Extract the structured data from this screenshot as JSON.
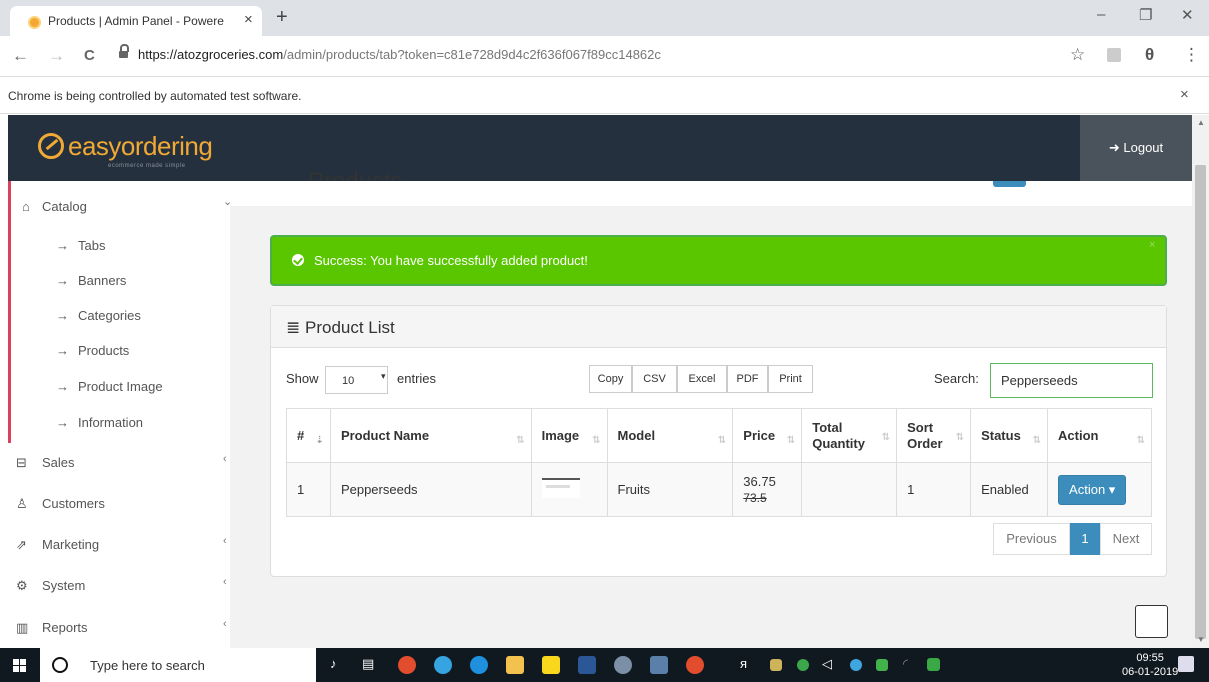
{
  "browser": {
    "tab_title": "Products | Admin Panel - Powere",
    "tab_close": "×",
    "new_tab": "+",
    "url_host": "https://atozgroceries.com",
    "url_path": "/admin/products/tab?token=c81e728d9d4c2f636f067f89cc14862c",
    "infobar_text": "Chrome is being controlled by automated test software.",
    "infobar_close": "×",
    "back": "←",
    "forward": "→",
    "reload": "C",
    "star": "☆",
    "profile": "θ",
    "menu": "⋮",
    "minimize": "–",
    "restore": "❐",
    "close": "✕"
  },
  "header": {
    "logo_text": "easyordering",
    "logo_tagline": "ecommerce made simple",
    "logout_label": "Logout",
    "logout_icon": "➜"
  },
  "page": {
    "title": "Products"
  },
  "sidebar": {
    "catalog": "Catalog",
    "catalog_chevron": "⌄",
    "sub_items": [
      "Tabs",
      "Banners",
      "Categories",
      "Products",
      "Product Image",
      "Information"
    ],
    "arrow": "→",
    "sales": "Sales",
    "customers": "Customers",
    "marketing": "Marketing",
    "system": "System",
    "reports": "Reports",
    "chevron_left": "‹"
  },
  "alert": {
    "message": "Success: You have successfully added product!",
    "close": "×"
  },
  "panel": {
    "title": "Product List",
    "title_icon": "≣"
  },
  "datatable": {
    "show_label": "Show",
    "length_value": "10",
    "length_caret": "▾",
    "entries_label": "entries",
    "buttons": [
      "Copy",
      "CSV",
      "Excel",
      "PDF",
      "Print"
    ],
    "search_label": "Search:",
    "search_value": "Pepperseeds",
    "columns": [
      "#",
      "Product Name",
      "Image",
      "Model",
      "Price",
      "Total Quantity",
      "Sort Order",
      "Status",
      "Action"
    ],
    "sort_icon": "⇅",
    "rows": [
      {
        "index": "1",
        "name": "Pepperseeds",
        "model": "Fruits",
        "price": "36.75",
        "old_price": "73.5",
        "quantity": "",
        "sort_order": "1",
        "status": "Enabled",
        "action": "Action ▾"
      }
    ],
    "pager": {
      "previous": "Previous",
      "current": "1",
      "next": "Next"
    }
  },
  "taskbar": {
    "search_placeholder": "Type here to search",
    "time": "09:55",
    "date": "06-01-2019"
  },
  "colors": {
    "header_bg": "#24303d",
    "accent": "#f0a935",
    "success": "#59c600",
    "primary": "#3c8dbc",
    "sidebar_accent": "#d9415d"
  }
}
